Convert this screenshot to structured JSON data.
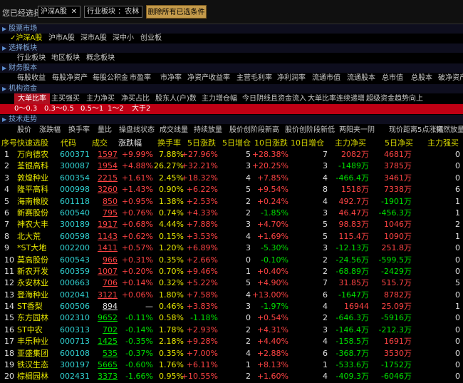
{
  "top": {
    "label": "您已经选择",
    "market": "沪深A股",
    "sector": "行业板块 ：农林",
    "clear": "删除所有已选条件"
  },
  "sections": {
    "market": "股票市场",
    "sector": "选择板块",
    "finance": "财务股本",
    "inst": "机构资金",
    "tech": "技术走势"
  },
  "markets": [
    "沪深A股",
    "沪市A股",
    "深市A股",
    "深中小",
    "创业板"
  ],
  "sector_tabs": [
    "行业板块",
    "地区板块",
    "概念板块"
  ],
  "finance_items": [
    "每股收益",
    "每股净资产",
    "每股公积金",
    "市盈率",
    "市净率",
    "净资产收益率",
    "主营毛利率",
    "净利润率",
    "流通市值",
    "流通股本",
    "总市值",
    "总股本",
    "破净资产"
  ],
  "inst_tabs": [
    "大单比率",
    "主买强买",
    "主力净买",
    "净买占比",
    "股东人(户)数",
    "主力增仓幅",
    "今日阴线且资金流入",
    "大单比率连续递增",
    "超级资金趋势向上"
  ],
  "ratio_ranges": [
    "0～0.3",
    "0.3～0.5",
    "0.5～1",
    "1～2",
    "大于2"
  ],
  "tech_items": [
    "股价",
    "涨跌幅",
    "换手率",
    "量比",
    "操盘线状态",
    "成交线量",
    "持续放量",
    "股价创阶段新高",
    "股价创阶段新低",
    "两阳夹一阴",
    "现价距离5点涨幅",
    "突然放量"
  ],
  "headers": [
    "序号",
    "快速选股",
    "代码",
    "成交",
    "涨跌幅",
    "换手率",
    "5日涨跌",
    "5日增仓",
    "10日涨跌",
    "10日增仓",
    "主力净买",
    "5日净买",
    "主力强买"
  ],
  "rows": [
    [
      "1",
      "万向德农",
      "600371",
      "1597",
      "+9.99%",
      "7.88%",
      "+27.96%",
      "5",
      "+28.38%",
      "7",
      "2082万",
      "4681万",
      "0"
    ],
    [
      "2",
      "荃银高科",
      "300087",
      "1954",
      "+4.88%",
      "26.27%",
      "+32.21%",
      "3",
      "+20.25%",
      "3",
      "-1489万",
      "3785万",
      "0"
    ],
    [
      "3",
      "敦煌种业",
      "600354",
      "2215",
      "+1.61%",
      "2.45%",
      "+18.32%",
      "4",
      "+7.85%",
      "4",
      "-466.4万",
      "3461万",
      "0"
    ],
    [
      "4",
      "隆平高科",
      "000998",
      "3260",
      "+1.43%",
      "0.90%",
      "+6.22%",
      "5",
      "+9.54%",
      "8",
      "1518万",
      "7338万",
      "6"
    ],
    [
      "5",
      "海南橡胶",
      "601118",
      "850",
      "+0.95%",
      "1.38%",
      "+2.53%",
      "2",
      "+0.24%",
      "4",
      "492.7万",
      "-1901万",
      "1"
    ],
    [
      "6",
      "新赛股份",
      "600540",
      "795",
      "+0.76%",
      "0.74%",
      "+4.33%",
      "2",
      "-1.85%",
      "3",
      "46.47万",
      "-456.3万",
      "1"
    ],
    [
      "7",
      "神农大丰",
      "300189",
      "1917",
      "+0.68%",
      "4.44%",
      "+7.88%",
      "3",
      "+4.70%",
      "5",
      "98.83万",
      "1046万",
      "2"
    ],
    [
      "8",
      "北大荒",
      "600598",
      "1143",
      "+0.62%",
      "0.15%",
      "+3.53%",
      "4",
      "+1.69%",
      "5",
      "115.4万",
      "1090万",
      "1"
    ],
    [
      "9",
      "*ST大地",
      "002200",
      "1411",
      "+0.57%",
      "1.20%",
      "+6.89%",
      "3",
      "-5.30%",
      "3",
      "-12.13万",
      "251.8万",
      "0"
    ],
    [
      "10",
      "莫高股份",
      "600543",
      "966",
      "+0.31%",
      "0.35%",
      "+2.66%",
      "0",
      "-0.10%",
      "2",
      "-24.56万",
      "-599.5万",
      "0"
    ],
    [
      "11",
      "新农开发",
      "600359",
      "1007",
      "+0.20%",
      "0.70%",
      "+9.46%",
      "1",
      "+0.40%",
      "2",
      "-68.89万",
      "-2429万",
      "0"
    ],
    [
      "12",
      "永安林业",
      "000663",
      "706",
      "+0.14%",
      "0.32%",
      "+5.22%",
      "5",
      "+4.90%",
      "7",
      "31.85万",
      "515.7万",
      "5"
    ],
    [
      "13",
      "登海种业",
      "002041",
      "3121",
      "+0.06%",
      "1.80%",
      "+7.58%",
      "4",
      "+13.00%",
      "6",
      "-1647万",
      "8782万",
      "0"
    ],
    [
      "14",
      "ST香梨",
      "600506",
      "894",
      "—",
      "0.46%",
      "+3.83%",
      "3",
      "-1.97%",
      "4",
      "16944",
      "25.09万",
      "1"
    ],
    [
      "15",
      "东方园林",
      "002310",
      "9652",
      "-0.11%",
      "0.58%",
      "-1.18%",
      "0",
      "+0.54%",
      "2",
      "-646.3万",
      "-5916万",
      "0"
    ],
    [
      "16",
      "ST中农",
      "600313",
      "702",
      "-0.14%",
      "1.78%",
      "+2.93%",
      "2",
      "+4.31%",
      "3",
      "-146.4万",
      "-212.3万",
      "0"
    ],
    [
      "17",
      "丰乐种业",
      "000713",
      "1425",
      "-0.35%",
      "2.18%",
      "+9.28%",
      "2",
      "+4.40%",
      "4",
      "-158.5万",
      "1691万",
      "0"
    ],
    [
      "18",
      "亚盛集团",
      "600108",
      "535",
      "-0.37%",
      "0.35%",
      "+7.00%",
      "4",
      "+2.88%",
      "6",
      "-368.7万",
      "3530万",
      "0"
    ],
    [
      "19",
      "铁汉生态",
      "300197",
      "5665",
      "-0.60%",
      "1.76%",
      "+6.11%",
      "1",
      "+8.13%",
      "1",
      "-533.6万",
      "-1752万",
      "0"
    ],
    [
      "20",
      "棕榈园林",
      "002431",
      "3373",
      "-1.66%",
      "0.95%",
      "+10.55%",
      "2",
      "+1.60%",
      "4",
      "-409.3万",
      "-6046万",
      "0"
    ]
  ]
}
